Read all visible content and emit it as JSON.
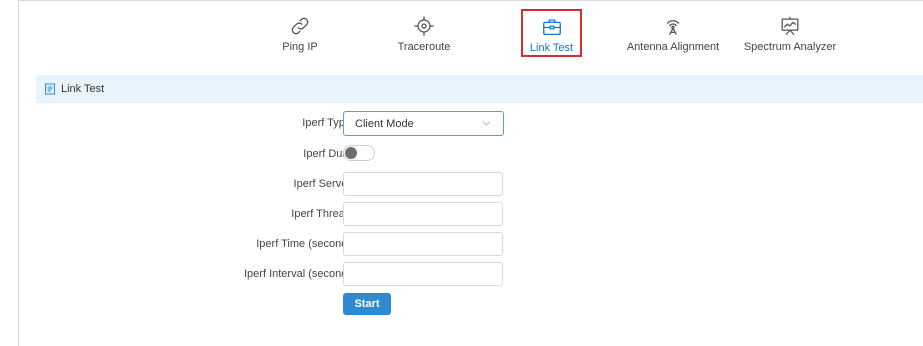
{
  "toolbar": {
    "items": [
      {
        "label": "Ping IP",
        "icon": "link-icon"
      },
      {
        "label": "Traceroute",
        "icon": "crosshair-icon"
      },
      {
        "label": "Link Test",
        "icon": "toolbox-icon"
      },
      {
        "label": "Antenna Alignment",
        "icon": "antenna-icon"
      },
      {
        "label": "Spectrum Analyzer",
        "icon": "spectrum-chart-icon"
      }
    ],
    "active": "Link Test"
  },
  "section": {
    "title": "Link Test",
    "icon": "document-icon"
  },
  "form": {
    "iperf_type": {
      "label": "Iperf Type",
      "value": "Client Mode"
    },
    "iperf_dual": {
      "label": "Iperf Dual",
      "enabled": false
    },
    "iperf_server": {
      "label": "Iperf Server",
      "value": ""
    },
    "iperf_thread": {
      "label": "Iperf Thread",
      "value": ""
    },
    "iperf_time": {
      "label": "Iperf Time (second)",
      "value": ""
    },
    "iperf_interval": {
      "label": "Iperf Interval (second)",
      "value": ""
    },
    "start_label": "Start"
  },
  "colors": {
    "accent": "#2d8ad1",
    "active_text": "#1a73c7",
    "highlight_border": "#d32f2f",
    "section_bg": "#e9f3fb"
  }
}
